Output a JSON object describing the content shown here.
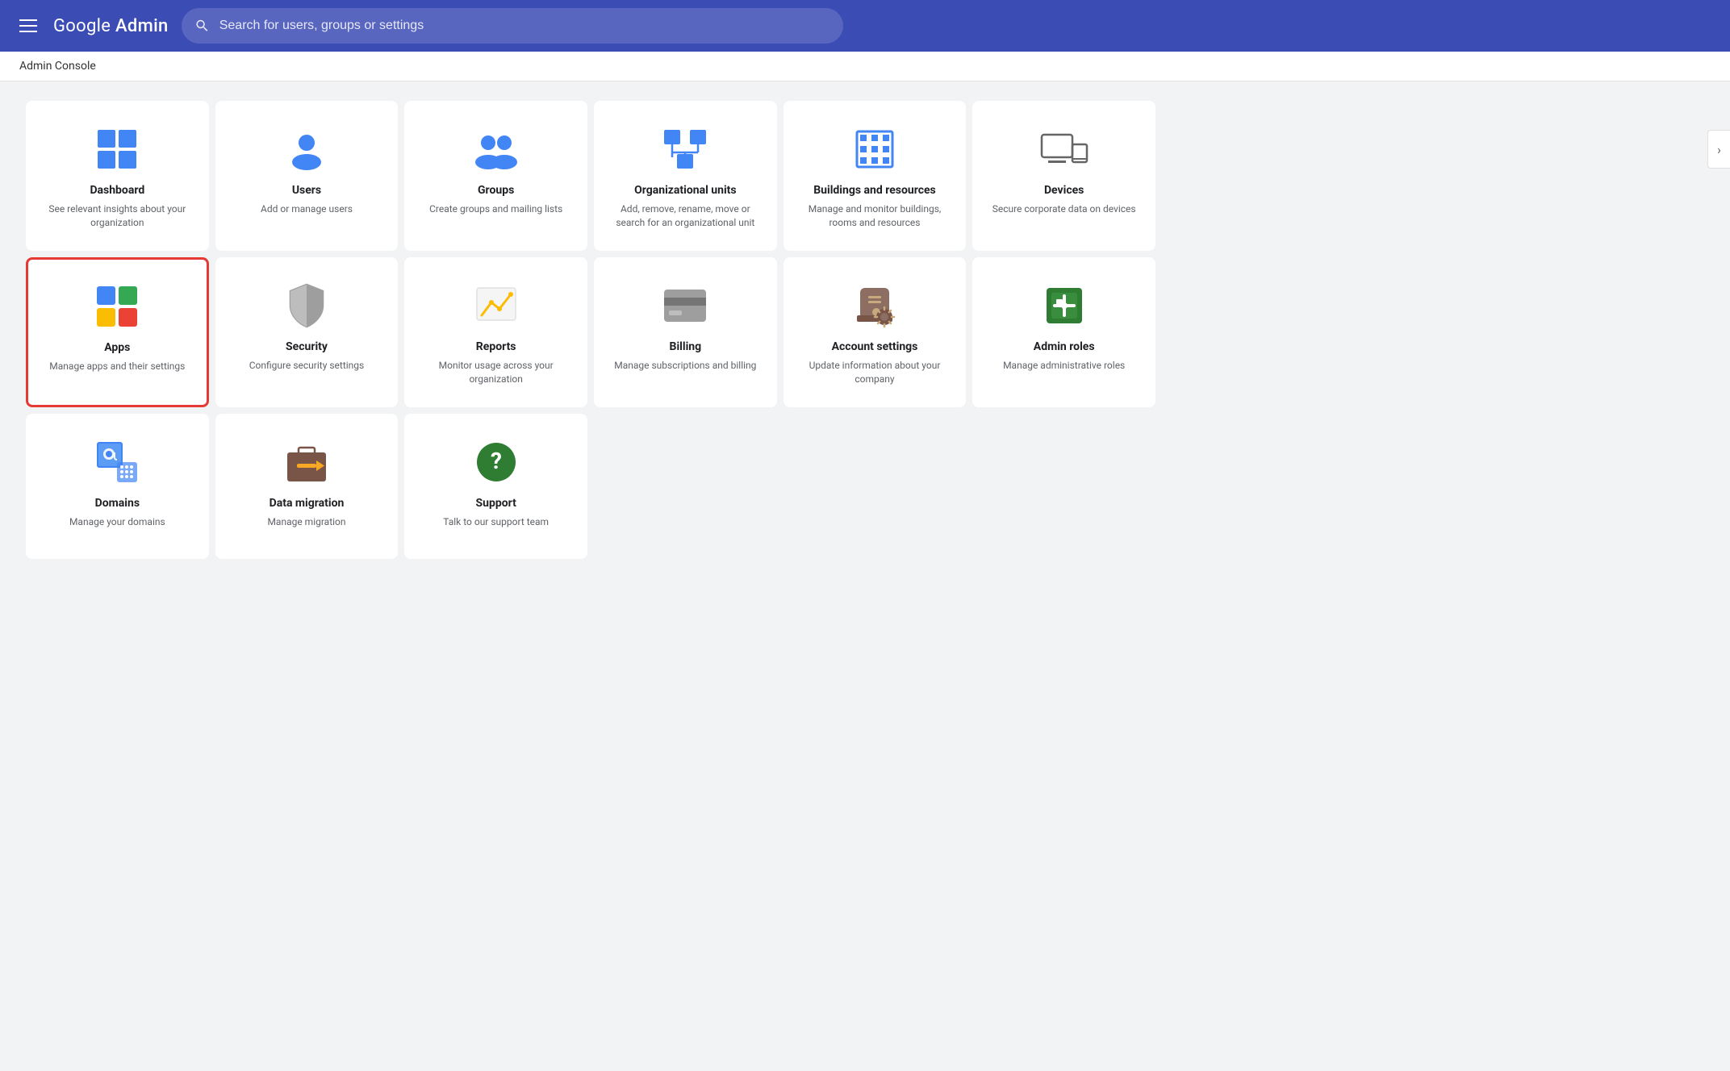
{
  "header": {
    "menu_label": "menu",
    "logo_text": "Google Admin",
    "search_placeholder": "Search for users, groups or settings"
  },
  "breadcrumb": "Admin Console",
  "chevron": "›",
  "cards": [
    {
      "id": "dashboard",
      "title": "Dashboard",
      "desc": "See relevant insights about your organization",
      "selected": false,
      "icon": "dashboard"
    },
    {
      "id": "users",
      "title": "Users",
      "desc": "Add or manage users",
      "selected": false,
      "icon": "users"
    },
    {
      "id": "groups",
      "title": "Groups",
      "desc": "Create groups and mailing lists",
      "selected": false,
      "icon": "groups"
    },
    {
      "id": "org-units",
      "title": "Organizational units",
      "desc": "Add, remove, rename, move or search for an organizational unit",
      "selected": false,
      "icon": "org-units"
    },
    {
      "id": "buildings",
      "title": "Buildings and resources",
      "desc": "Manage and monitor buildings, rooms and resources",
      "selected": false,
      "icon": "buildings"
    },
    {
      "id": "devices",
      "title": "Devices",
      "desc": "Secure corporate data on devices",
      "selected": false,
      "icon": "devices"
    },
    {
      "id": "apps",
      "title": "Apps",
      "desc": "Manage apps and their settings",
      "selected": true,
      "icon": "apps"
    },
    {
      "id": "security",
      "title": "Security",
      "desc": "Configure security settings",
      "selected": false,
      "icon": "security"
    },
    {
      "id": "reports",
      "title": "Reports",
      "desc": "Monitor usage across your organization",
      "selected": false,
      "icon": "reports"
    },
    {
      "id": "billing",
      "title": "Billing",
      "desc": "Manage subscriptions and billing",
      "selected": false,
      "icon": "billing"
    },
    {
      "id": "account-settings",
      "title": "Account settings",
      "desc": "Update information about your company",
      "selected": false,
      "icon": "account-settings"
    },
    {
      "id": "admin-roles",
      "title": "Admin roles",
      "desc": "Manage administrative roles",
      "selected": false,
      "icon": "admin-roles"
    },
    {
      "id": "domains",
      "title": "Domains",
      "desc": "Manage your domains",
      "selected": false,
      "icon": "domains"
    },
    {
      "id": "data-migration",
      "title": "Data migration",
      "desc": "Manage migration",
      "selected": false,
      "icon": "data-migration"
    },
    {
      "id": "support",
      "title": "Support",
      "desc": "Talk to our support team",
      "selected": false,
      "icon": "support"
    }
  ]
}
